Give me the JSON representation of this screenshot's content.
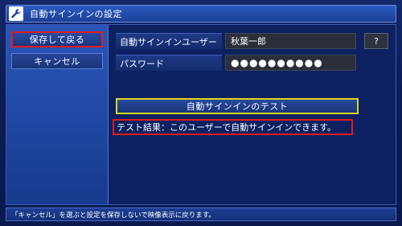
{
  "window": {
    "title": "自動サインインの設定",
    "icon": "wrench-icon"
  },
  "sidebar": {
    "items": [
      {
        "label": "保存して戻る",
        "selected": true
      },
      {
        "label": "キャンセル",
        "selected": false
      }
    ]
  },
  "form": {
    "user_label": "自動サインインユーザー",
    "user_value": "秋葉一郎",
    "password_label": "パスワード",
    "password_value": "●●●●●●●●●●",
    "help_label": "?"
  },
  "test": {
    "button_label": "自動サインインのテスト",
    "result_text": "テスト結果：このユーザーで自動サインインできます。"
  },
  "status": {
    "text": "「キャンセル」を選ぶと設定を保存しないで映像表示に戻ります。"
  },
  "colors": {
    "selection_red": "#e21b1b",
    "focus_yellow": "#d9d81e",
    "background": "#0a1a4e"
  }
}
